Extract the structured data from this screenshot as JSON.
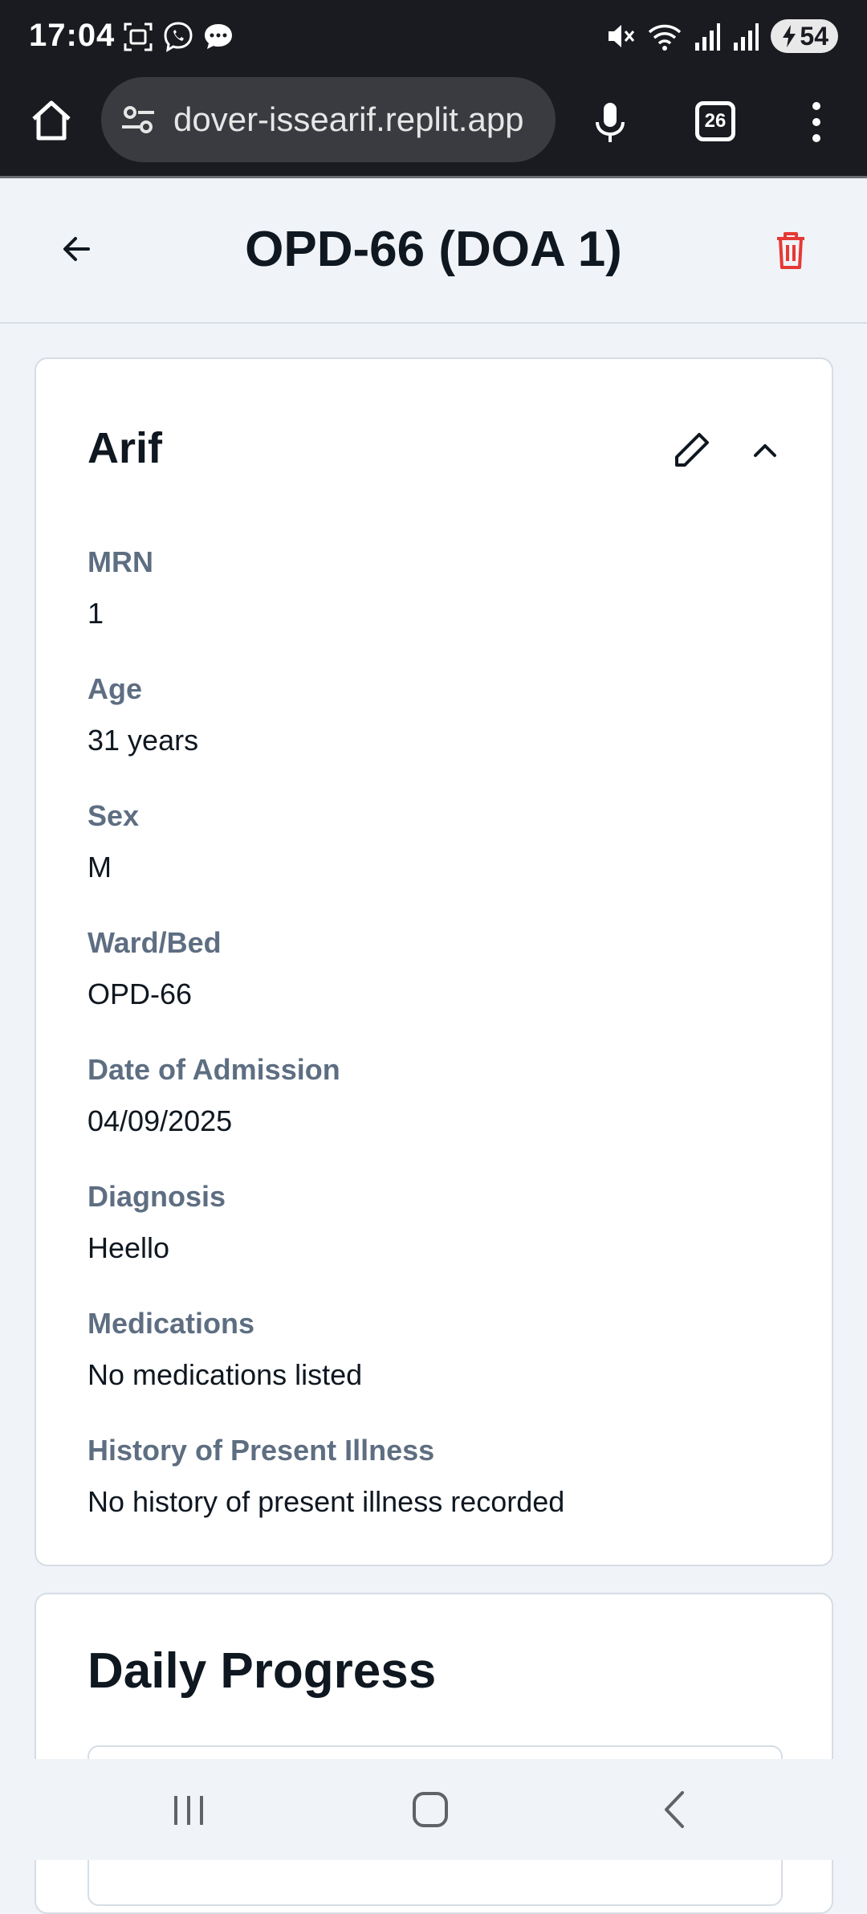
{
  "status_bar": {
    "time": "17:04",
    "battery": "54"
  },
  "browser": {
    "url": "dover-issearif.replit.app",
    "tab_count": "26"
  },
  "header": {
    "title": "OPD-66 (DOA 1)"
  },
  "patient": {
    "name": "Arif",
    "fields": [
      {
        "label": "MRN",
        "value": "1"
      },
      {
        "label": "Age",
        "value": "31 years"
      },
      {
        "label": "Sex",
        "value": "M"
      },
      {
        "label": "Ward/Bed",
        "value": "OPD-66"
      },
      {
        "label": "Date of Admission",
        "value": "04/09/2025"
      },
      {
        "label": "Diagnosis",
        "value": "Heello"
      },
      {
        "label": "Medications",
        "value": "No medications listed"
      },
      {
        "label": "History of Present Illness",
        "value": "No history of present illness recorded"
      }
    ]
  },
  "progress": {
    "title": "Daily Progress"
  },
  "colors": {
    "delete_red": "#e53935",
    "label_gray": "#5e6e82",
    "bar_dark": "#1a1b21"
  }
}
